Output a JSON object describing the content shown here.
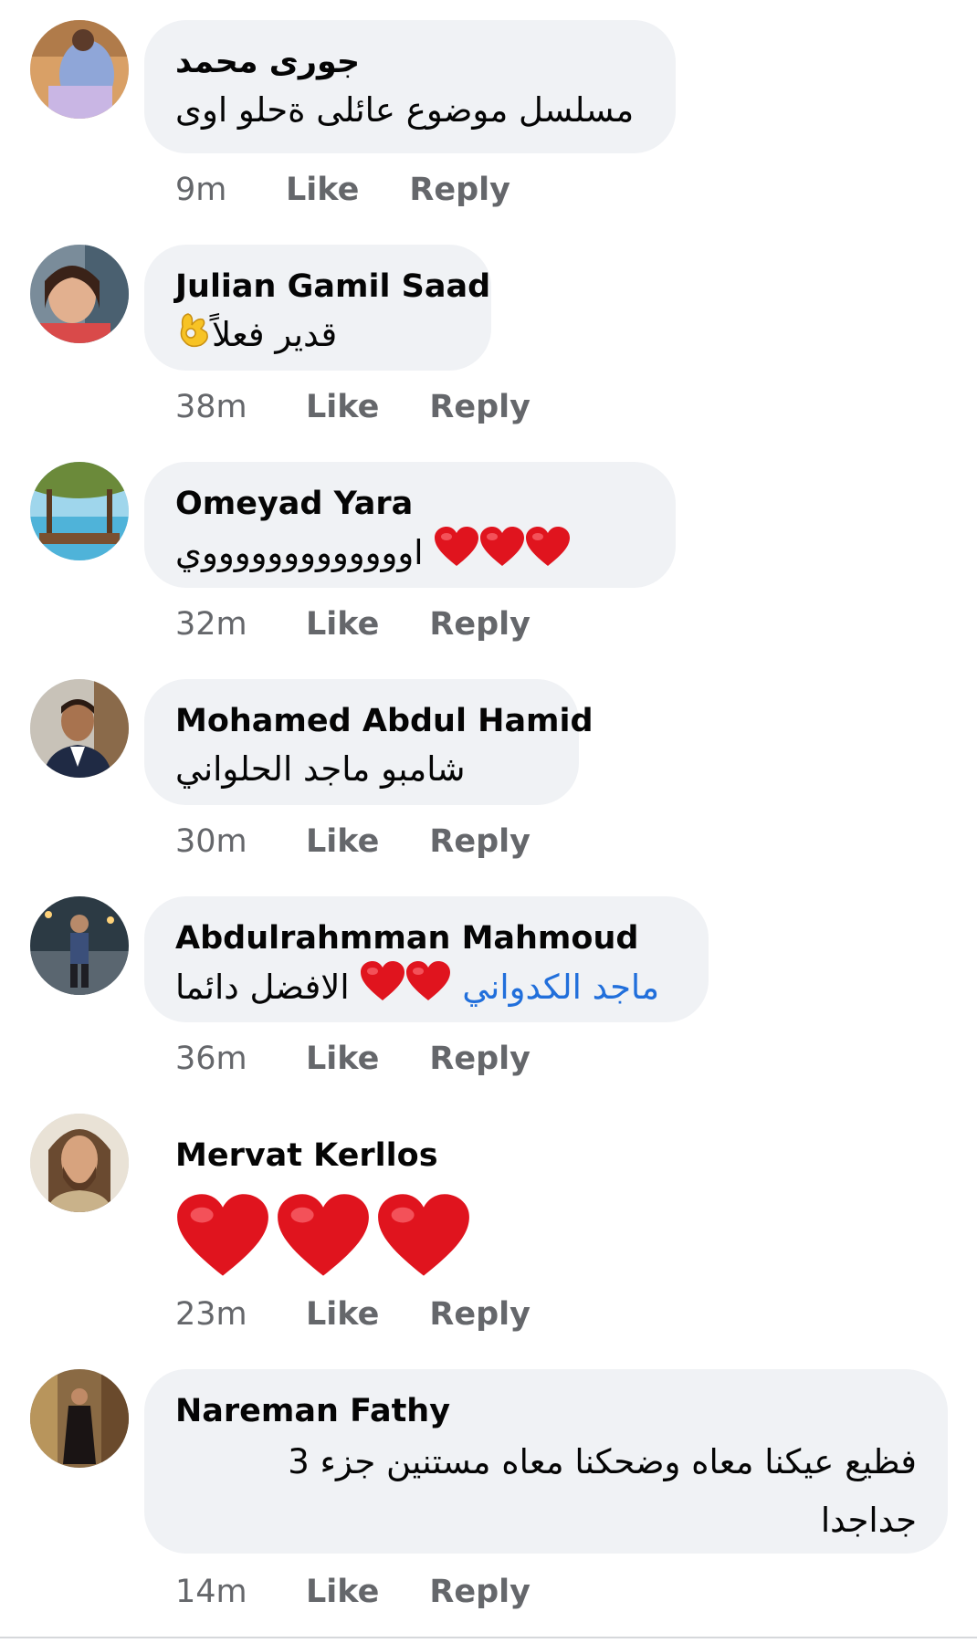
{
  "comments": [
    {
      "author": "جورى محمد",
      "text": "مسلسل موضوع عائلى ةحلو اوى",
      "time": "9m",
      "like": "Like",
      "reply": "Reply"
    },
    {
      "author": "Julian Gamil Saad",
      "text": "قدير فعلاً",
      "emoji": "ok-hand",
      "time": "38m",
      "like": "Like",
      "reply": "Reply"
    },
    {
      "author": "Omeyad Yara",
      "text": "اوووووووووووووي",
      "emoji": "heart",
      "emoji_count": 3,
      "time": "32m",
      "like": "Like",
      "reply": "Reply"
    },
    {
      "author": "Mohamed Abdul Hamid",
      "text": "شامبو ماجد الحلواني",
      "time": "30m",
      "like": "Like",
      "reply": "Reply"
    },
    {
      "author": "Abdulrahmman Mahmoud",
      "text": "الافضل دائما",
      "mention": "ماجد الكدواني",
      "emoji": "heart",
      "emoji_count": 2,
      "time": "36m",
      "like": "Like",
      "reply": "Reply"
    },
    {
      "author": "Mervat Kerllos",
      "emoji": "heart",
      "emoji_count": 3,
      "time": "23m",
      "like": "Like",
      "reply": "Reply"
    },
    {
      "author": "Nareman Fathy",
      "text_line1": "فظيع عيكنا معاه وضحكنا معاه مستنين جزء 3",
      "text_line2": "جداجدا",
      "time": "14m",
      "like": "Like",
      "reply": "Reply"
    }
  ],
  "colors": {
    "bubble": "#f0f2f5",
    "meta": "#65676b",
    "mention": "#216fdb",
    "heart": "#e0141e"
  }
}
